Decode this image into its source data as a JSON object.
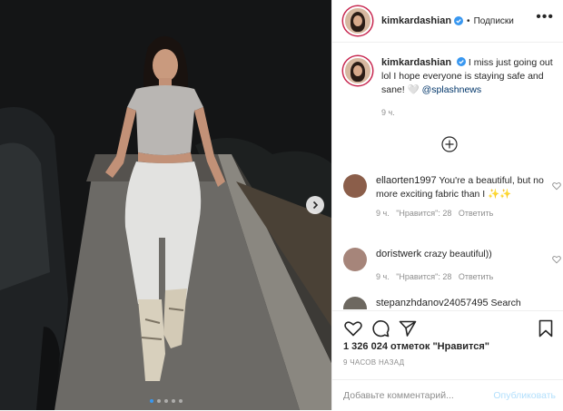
{
  "header": {
    "username": "kimkardashian",
    "separator": "•",
    "follow_label": "Подписки",
    "more_label": "•••"
  },
  "caption": {
    "username": "kimkardashian",
    "text": "I miss just going out lol I hope everyone is staying safe and sane! 🤍",
    "mention": "@splashnews",
    "time": "9 ч."
  },
  "comments": [
    {
      "username": "ellaorten1997",
      "text": "You're a beautiful, but no more exciting fabric than I ✨✨",
      "time": "9 ч.",
      "likes": "\"Нравится\": 28",
      "reply": "Ответить"
    },
    {
      "username": "doristwerk",
      "text": "crazy beautiful))",
      "time": "9 ч.",
      "likes": "\"Нравится\": 28",
      "reply": "Ответить"
    },
    {
      "username": "stepanzhdanov24057495",
      "text": "Search"
    }
  ],
  "actions": {
    "likes_count": "1 326 024 отметок \"Нравится\"",
    "time_ago": "9 ЧАСОВ НАЗАД"
  },
  "add_comment": {
    "placeholder": "Добавьте комментарий...",
    "post_label": "Опубликовать"
  },
  "carousel": {
    "total": 5,
    "current": 1
  },
  "colors": {
    "accent": "#3897f0",
    "post_disabled": "#b2dffc",
    "muted": "#8e8e8e"
  },
  "icons": [
    "verified-icon",
    "more-options-icon",
    "load-more-comments-icon",
    "like-icon",
    "comment-icon",
    "share-icon",
    "save-icon",
    "next-slide-icon"
  ]
}
